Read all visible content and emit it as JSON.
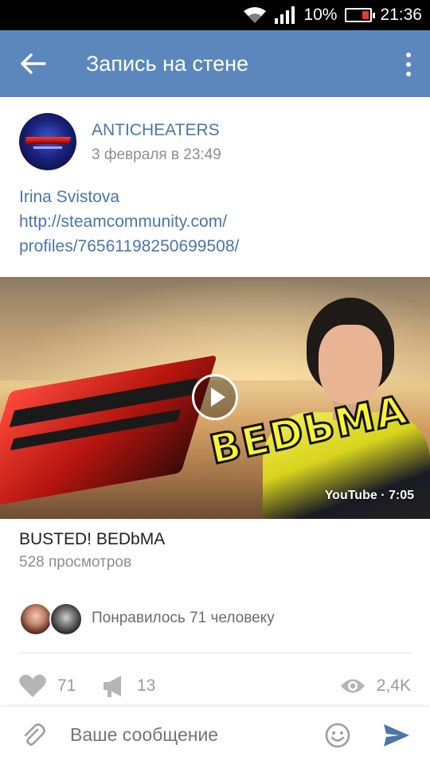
{
  "status_bar": {
    "battery": "10%",
    "time": "21:36"
  },
  "app_bar": {
    "title": "Запись на стене"
  },
  "post": {
    "author": "ANTICHEATERS",
    "date": "3 февраля в 23:49",
    "text_lines": [
      "Irina Svistova",
      "http://steamcommunity.com/",
      "profiles/76561198250699508/"
    ],
    "video": {
      "overlay_text": "BEDЬMA",
      "source_duration": "YouTube · 7:05",
      "title": "BUSTED! BEDbMA",
      "views": "528 просмотров"
    },
    "likes_summary": "Понравилось 71 человеку",
    "counts": {
      "likes": "71",
      "shares": "13",
      "views": "2,4K"
    }
  },
  "composer": {
    "placeholder": "Ваше сообщение"
  },
  "colors": {
    "app_bar": "#5b87bd",
    "link": "#4a76a8",
    "send": "#4a76a8"
  }
}
